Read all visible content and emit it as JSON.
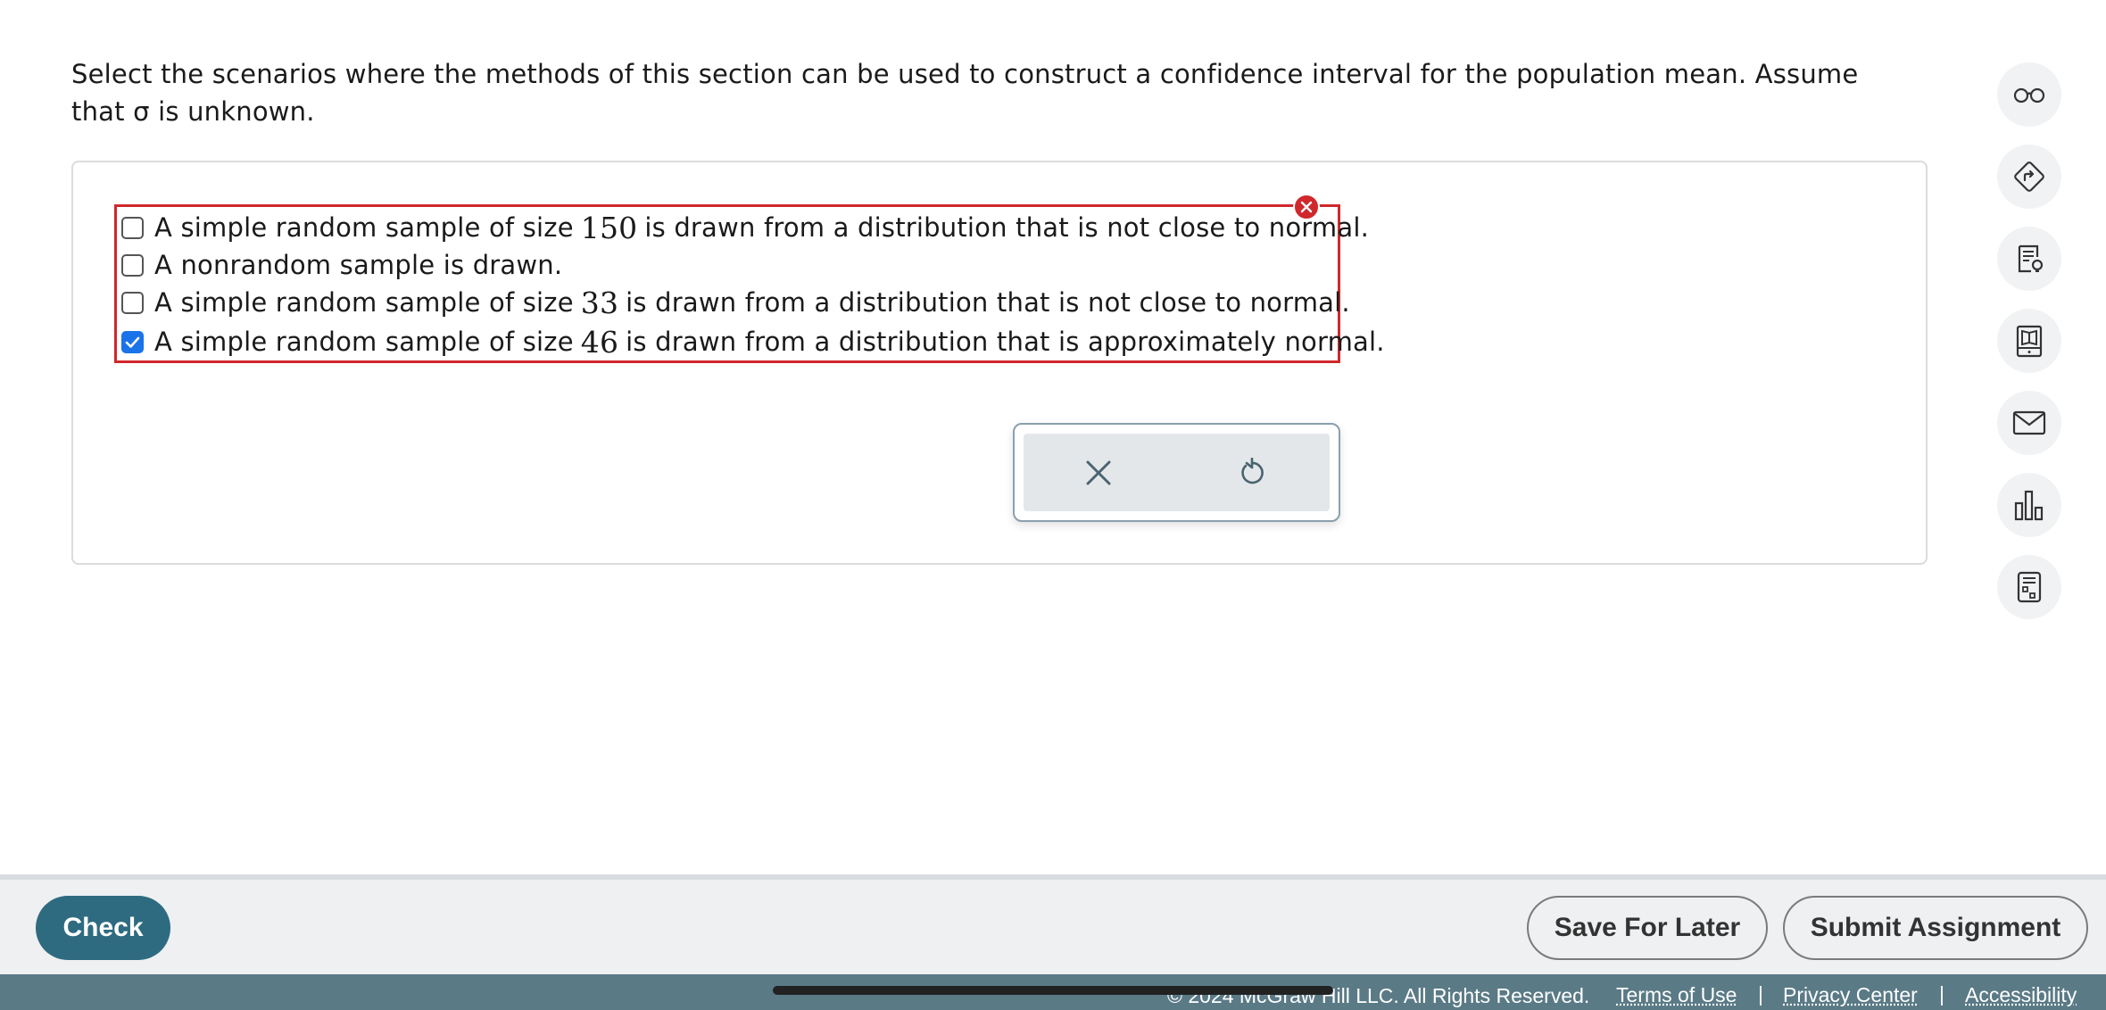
{
  "question": {
    "text": "Select the scenarios where the methods of this section can be used to construct a confidence interval for the population mean. Assume that σ is unknown."
  },
  "choices": [
    {
      "pre": "A simple random sample of size",
      "num": "150",
      "post": "is drawn from a distribution that is not close to normal.",
      "checked": false
    },
    {
      "pre": "A nonrandom sample is drawn.",
      "num": "",
      "post": "",
      "checked": false
    },
    {
      "pre": "A simple random sample of size",
      "num": "33",
      "post": "is drawn from a distribution that is not close to normal.",
      "checked": false
    },
    {
      "pre": "A simple random sample of size",
      "num": "46",
      "post": "is drawn from a distribution that is approximately normal.",
      "checked": true
    }
  ],
  "status": {
    "error_color": "#d0282c"
  },
  "tools_popup": {
    "clear_icon": "close-icon",
    "reset_icon": "undo-icon"
  },
  "side_tools": [
    "glasses-icon",
    "directions-icon",
    "hint-icon",
    "ebook-icon",
    "mail-icon",
    "chart-icon",
    "calculator-icon"
  ],
  "actions": {
    "check_label": "Check",
    "save_label": "Save For Later",
    "submit_label": "Submit Assignment"
  },
  "footer": {
    "copyright": "© 2024 McGraw Hill LLC. All Rights Reserved.",
    "terms": "Terms of Use",
    "privacy": "Privacy Center",
    "accessibility": "Accessibility",
    "separator": "|"
  },
  "colors": {
    "accent": "#2e6b80",
    "checkbox": "#1a73e8",
    "footer": "#5a7a86"
  }
}
